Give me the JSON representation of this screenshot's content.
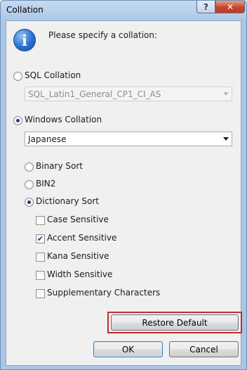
{
  "window": {
    "title": "Collation",
    "help_label": "?",
    "close_label": "✕"
  },
  "header": {
    "icon": "info-icon",
    "icon_glyph": "i",
    "prompt": "Please specify a collation:"
  },
  "sql_collation": {
    "label": "SQL Collation",
    "selected": false,
    "value": "SQL_Latin1_General_CP1_CI_AS"
  },
  "windows_collation": {
    "label": "Windows Collation",
    "selected": true,
    "value": "Japanese"
  },
  "sort_options": [
    {
      "label": "Binary Sort",
      "selected": false
    },
    {
      "label": "BIN2",
      "selected": false
    },
    {
      "label": "Dictionary Sort",
      "selected": true
    }
  ],
  "sensitivity": [
    {
      "label": "Case Sensitive",
      "checked": false
    },
    {
      "label": "Accent Sensitive",
      "checked": true
    },
    {
      "label": "Kana Sensitive",
      "checked": false
    },
    {
      "label": "Width Sensitive",
      "checked": false
    },
    {
      "label": "Supplementary Characters",
      "checked": false
    }
  ],
  "buttons": {
    "restore_default": "Restore Default",
    "ok": "OK",
    "cancel": "Cancel"
  },
  "colors": {
    "highlight": "#c42b2b"
  }
}
